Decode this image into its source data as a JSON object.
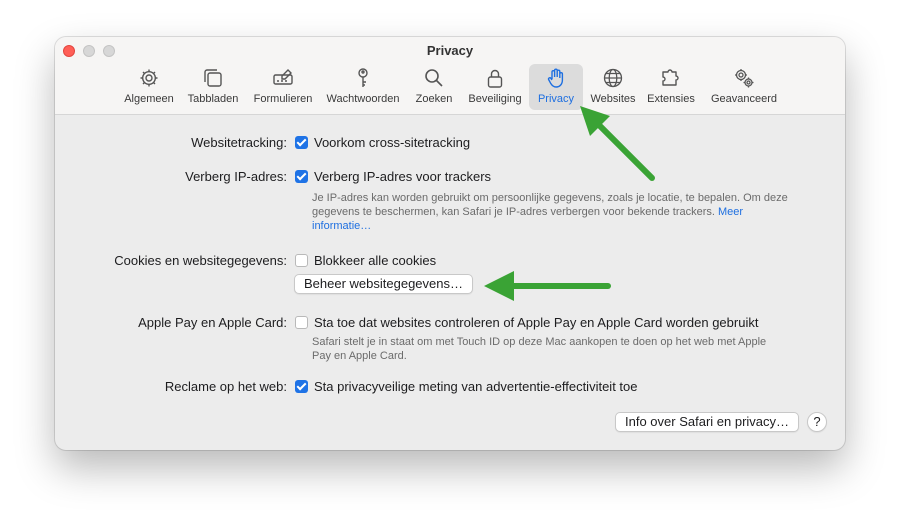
{
  "window": {
    "title": "Privacy"
  },
  "toolbar": {
    "items": [
      {
        "label": "Algemeen",
        "icon": "gear-icon"
      },
      {
        "label": "Tabbladen",
        "icon": "tabs-icon"
      },
      {
        "label": "Formulieren",
        "icon": "autofill-icon"
      },
      {
        "label": "Wachtwoorden",
        "icon": "key-icon"
      },
      {
        "label": "Zoeken",
        "icon": "search-icon"
      },
      {
        "label": "Beveiliging",
        "icon": "lock-icon"
      },
      {
        "label": "Privacy",
        "icon": "hand-icon",
        "active": true
      },
      {
        "label": "Websites",
        "icon": "globe-icon"
      },
      {
        "label": "Extensies",
        "icon": "puzzle-icon"
      },
      {
        "label": "Geavanceerd",
        "icon": "gears-icon"
      }
    ]
  },
  "settings": {
    "tracking": {
      "label": "Websitetracking:",
      "option": "Voorkom cross-sitetracking",
      "checked": true
    },
    "ip": {
      "label": "Verberg IP-adres:",
      "option": "Verberg IP-adres voor trackers",
      "checked": true,
      "help": "Je IP-adres kan worden gebruikt om persoonlijke gegevens, zoals je locatie, te bepalen. Om deze gegevens te beschermen, kan Safari je IP-adres verbergen voor bekende trackers.",
      "link": "Meer informatie…"
    },
    "cookies": {
      "label": "Cookies en websitegegevens:",
      "option": "Blokkeer alle cookies",
      "checked": false,
      "button": "Beheer websitegegevens…"
    },
    "applepay": {
      "label": "Apple Pay en Apple Card:",
      "option": "Sta toe dat websites controleren of Apple Pay en Apple Card worden gebruikt",
      "checked": false,
      "help": "Safari stelt je in staat om met Touch ID op deze Mac aankopen te doen op het web met Apple Pay en Apple Card."
    },
    "ads": {
      "label": "Reclame op het web:",
      "option": "Sta privacyveilige meting van advertentie-effectiviteit toe",
      "checked": true
    }
  },
  "footer": {
    "info_button": "Info over Safari en privacy…",
    "help_button": "?"
  },
  "colors": {
    "accent": "#1e6fe0",
    "arrow": "#3aa335",
    "close": "#ff5f57"
  }
}
